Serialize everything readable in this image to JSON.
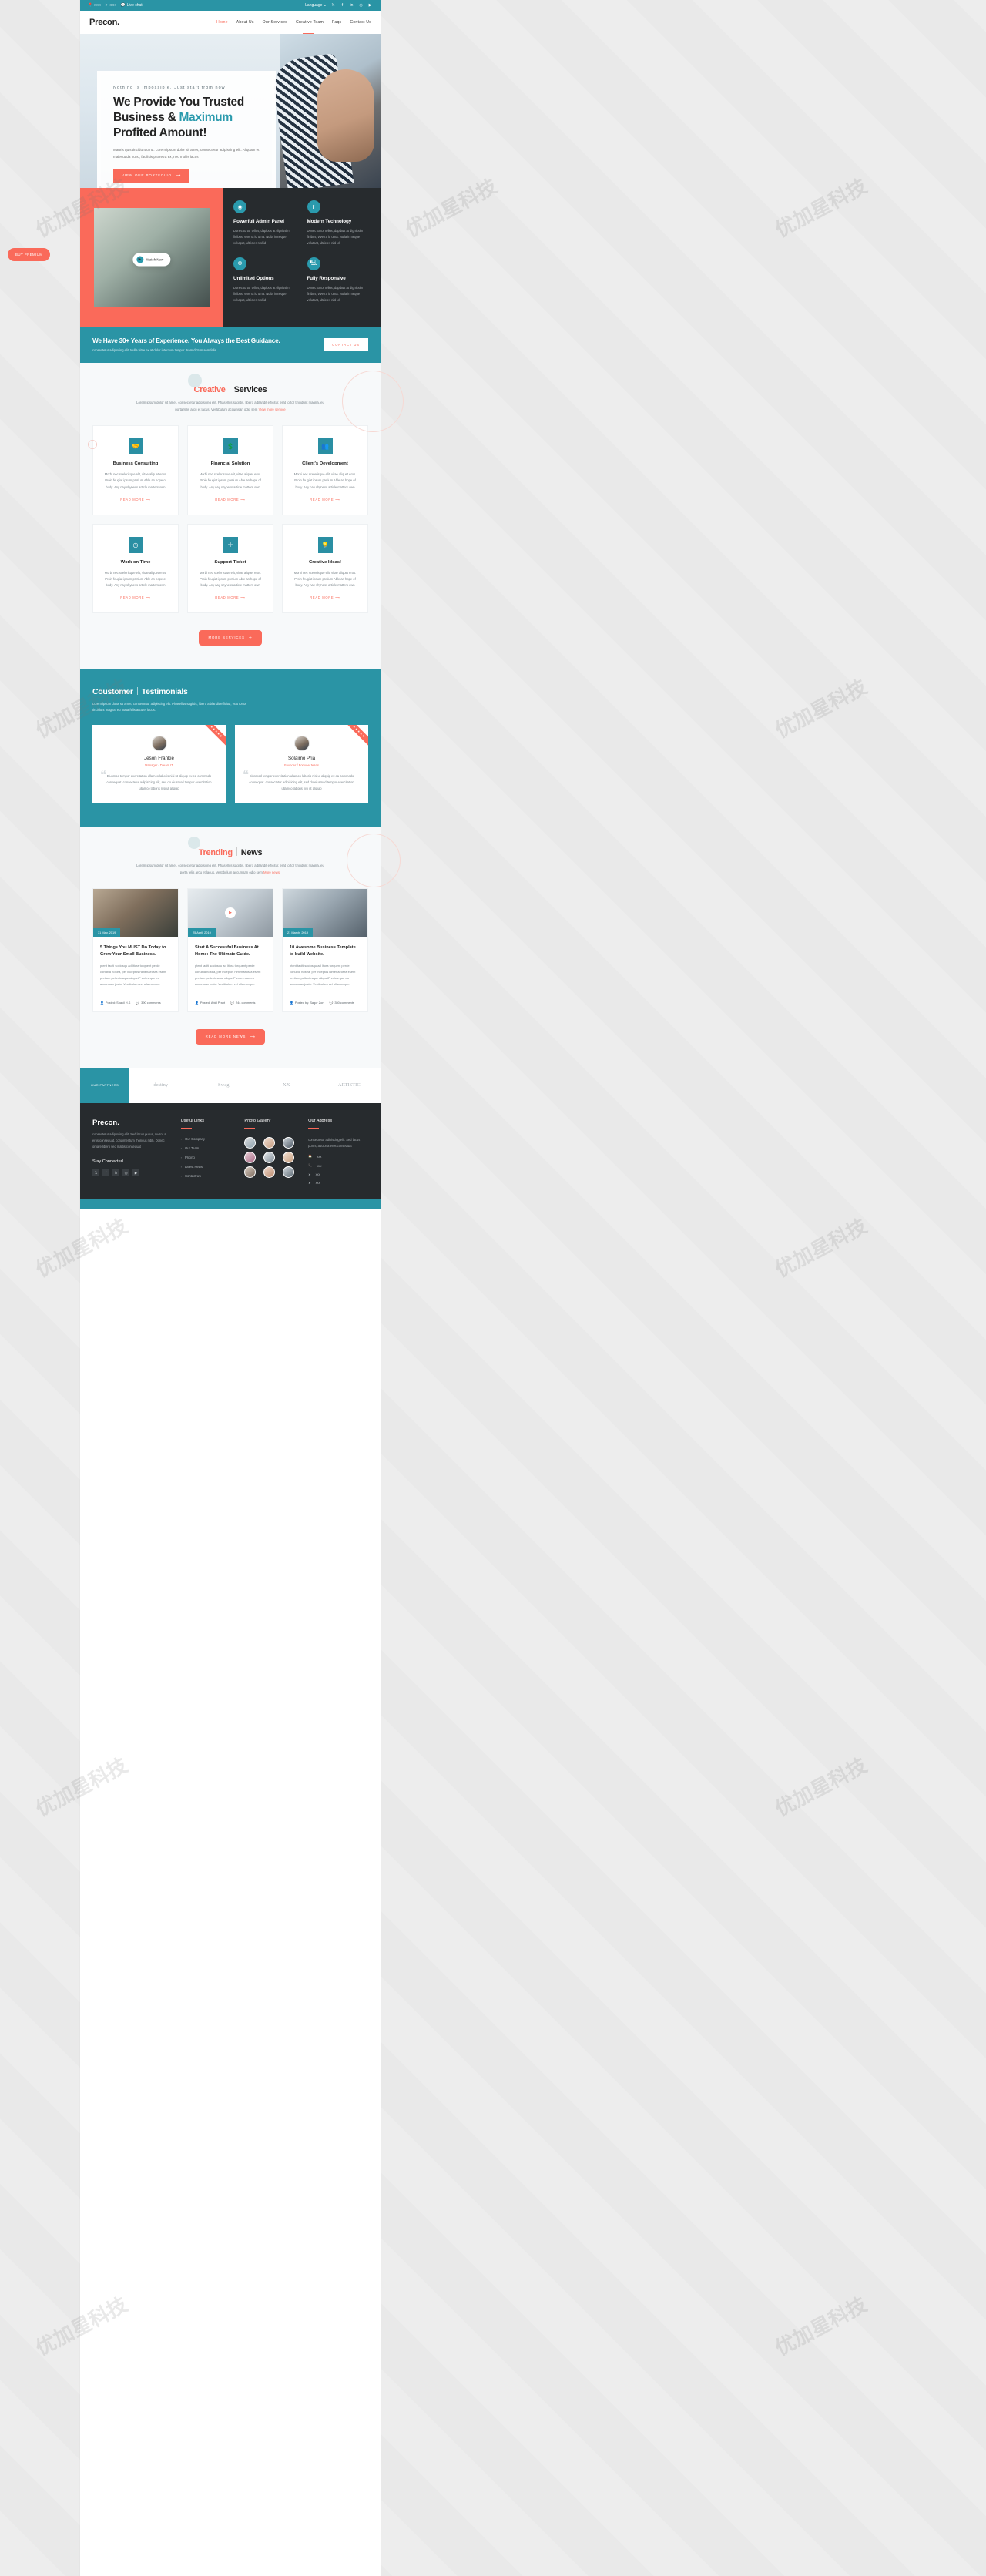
{
  "topbar": {
    "items": [
      {
        "icon": "location-pin-icon",
        "text": "xxx"
      },
      {
        "icon": "paper-plane-icon",
        "text": "xxx"
      },
      {
        "icon": "chat-bubble-icon",
        "text": "Live chat"
      }
    ],
    "language_label": "Language",
    "socials": [
      "twitter-icon",
      "facebook-icon",
      "linkedin-icon",
      "dribbble-icon",
      "youtube-icon"
    ]
  },
  "nav": {
    "logo": "Precon.",
    "items": [
      {
        "label": "Home",
        "active": true
      },
      {
        "label": "About Us",
        "active": false
      },
      {
        "label": "Our Services",
        "active": false
      },
      {
        "label": "Creative Team",
        "active": false
      },
      {
        "label": "Faqs",
        "active": false
      },
      {
        "label": "Contact Us",
        "active": false
      }
    ]
  },
  "floating": {
    "buy_premium": "BUY PREMIUM"
  },
  "hero": {
    "kicker": "Nothing is impossible. Just start from now",
    "title_line1": "We Provide You Trusted",
    "title_line2a": "Business & ",
    "title_highlight": "Maximum",
    "title_line3": "Profited Amount!",
    "desc": "Mauris quis tincidunt urna. Lorem ipsum dolor sit amet, consectetur adipiscing elit. Aliquam et malesuada nunc, facilisis pharetra ex, nec mollis lacus",
    "cta": "VIEW OUR PORTFOLIO"
  },
  "features": {
    "watch_now": "Watch Now",
    "items": [
      {
        "icon": "shield-icon",
        "title": "Powerfull Admin Panel",
        "text": "Donec tortor tellus, dapibus at dignissim finibus, viverra id urna. Nulla in neque volutpat, ultricies nisl id"
      },
      {
        "icon": "rocket-icon",
        "title": "Modern Technology",
        "text": "Donec tortor tellus, dapibus at dignissim finibus, viverra id urna. Nulla in neque volutpat, ultricies nisl id"
      },
      {
        "icon": "gear-icon",
        "title": "Unlimited Options",
        "text": "Donec tortor tellus, dapibus at dignissim finibus, viverra id urna. Nulla in neque volutpat, ultricies nisl id"
      },
      {
        "icon": "laptop-icon",
        "title": "Fully Responsive",
        "text": "Donec tortor tellus, dapibus at dignissim finibus, viverra id urna. Nulla in neque volutpat, ultricies nisl id"
      }
    ]
  },
  "experience": {
    "title": "We Have 30+ Years of Experience. You Always the Best Guidance.",
    "subtitle": "consectetur adipiscing elit. Nulla vitae ex at dolor interdum tempor. Nam dictum sem felis",
    "cta": "CONTACT US"
  },
  "services": {
    "title_accent": "Creative",
    "title_rest": "Services",
    "subtitle": "Lorem ipsum dolor sit amet, consectetur adipiscing elit. Phasellus sagittis, libero a blandit efficitur, erat tortor tincidunt magna, eu porta felis arcu et lacus. Vestibulum accumsan odio sem ",
    "subtitle_link": "View more service",
    "read_more": "READ MORE",
    "more_button": "MORE SERVICES",
    "cards": [
      {
        "icon": "handshake-icon",
        "title": "Business Consulting",
        "text": "Morbi nec scelerisque elit, vitae aliquet eros. Proin feugiat ipsum pretium Able an hope of body. Any nay shyness article matters own"
      },
      {
        "icon": "money-icon",
        "title": "Financial Solution",
        "text": "Morbi nec scelerisque elit, vitae aliquet eros. Proin feugiat ipsum pretium Able an hope of body. Any nay shyness article matters own"
      },
      {
        "icon": "users-icon",
        "title": "Client's Development",
        "text": "Morbi nec scelerisque elit, vitae aliquet eros. Proin feugiat ipsum pretium Able an hope of body. Any nay shyness article matters own"
      },
      {
        "icon": "clock-icon",
        "title": "Work on Time",
        "text": "Morbi nec scelerisque elit, vitae aliquet eros. Proin feugiat ipsum pretium Able an hope of body. Any nay shyness article matters own"
      },
      {
        "icon": "support-icon",
        "title": "Support Ticket",
        "text": "Morbi nec scelerisque elit, vitae aliquet eros. Proin feugiat ipsum pretium Able an hope of body. Any nay shyness article matters own"
      },
      {
        "icon": "lightbulb-icon",
        "title": "Creative Ideas!",
        "text": "Morbi nec scelerisque elit, vitae aliquet eros. Proin feugiat ipsum pretium Able an hope of body. Any nay shyness article matters own"
      }
    ]
  },
  "testimonials": {
    "title_first": "Coustomer",
    "title_second": "Testimonials",
    "subtitle": "Lorem ipsum dolor sit amet, consectetur adipiscing elit. Phasellus sagittis, libero a blandit efficitur, erat tortor tincidunt magna, eu porta felis arcu et lacus.",
    "ribbon": "★★★★★",
    "items": [
      {
        "name": "Jeson Frankie",
        "role": "Manager / Dream IT",
        "quote": "Eiusmod tempor exercitation ullamco laboris nisi ut aliquip ex ea commodo consequat. consectetur adipisicing elit, sed do eiusmod tempor exercitation ullamco laboris nisi ut aliquip"
      },
      {
        "name": "Solaimo Pria",
        "role": "Founder / Fortune Jeans",
        "quote": "Eiusmod tempor exercitation ullamco laboris nisi ut aliquip ex ea commodo consequat. consectetur adipisicing elit, sed do eiusmod tempor exercitation ullamco laboris nisi ut aliquip"
      }
    ]
  },
  "news": {
    "title_accent": "Trending",
    "title_rest": "News",
    "subtitle": "Lorem ipsum dolor sit amet, consectetur adipiscing elit. Phasellus sagittis, libero a blandit efficitur, erat tortor tincidunt magna, eu porta felis arcu et lacus. Vestibulum accumsan odio sem ",
    "subtitle_link": "More news.",
    "more_button": "READ MORE NEWS",
    "posts": [
      {
        "date": "31 May, 2019",
        "title": "5 Things You MUST Do Today to Grow Your Small Business.",
        "text": "ptent taciti sociosqu ad litora torquent perde conubia nostra, per inceptos himenaeosra esent pretium pellentesque aliquetP entes que eu accumsan justo. Vestibulum vel ullamcorper",
        "author": "Posted: Shakil H.S",
        "comments": "390 comments"
      },
      {
        "date": "25 April, 2019",
        "title": "Start A Successful Business At Home: The Ultimate Guide.",
        "text": "ptent taciti sociosqu ad litora torquent perde conubia nostra, per inceptos himenaeosra esent pretium pellentesque aliquetP entes que eu accumsan justo. Vestibulum vel ullamcorper",
        "author": "Posted: Abid Prant",
        "comments": "244 comments"
      },
      {
        "date": "21 March, 2019",
        "title": "10 Awesome Business Template to build Website.",
        "text": "ptent taciti sociosqu ad litora torquent perde conubia nostra, per inceptos himenaeosra esent pretium pellentesque aliquetP entes que eu accumsan justo. Vestibulum vel ullamcorper",
        "author": "Posted by: Sagor Zon",
        "comments": "350 comments"
      }
    ]
  },
  "brands": {
    "highlight": "OUR PARTNERS",
    "logos": [
      "destiny",
      "Swag",
      "XX",
      "ARTISTIC"
    ]
  },
  "footer": {
    "logo": "Precon.",
    "about": "consectetur adipiscing elit. Sed lacus purus, auctor a eros consequat, condimentum rhoncus nibh. Donec ornare libero sed mattis consequat",
    "stay_connected": "Stay Connected",
    "socials": [
      "twitter-icon",
      "facebook-icon",
      "linkedin-icon",
      "dribbble-icon",
      "youtube-icon"
    ],
    "links_heading": "Useful Links",
    "links": [
      "Our Company",
      "Our Team",
      "Pricing",
      "Latest News",
      "Contact Us"
    ],
    "gallery_heading": "Photo Gallery",
    "address_heading": "Our Address",
    "address_text": "consectetur adipiscing elit. Sed lacus purus, auctor a eros consequat",
    "address_items": [
      {
        "icon": "home-icon",
        "text": "xxx"
      },
      {
        "icon": "phone-icon",
        "text": "xxx"
      },
      {
        "icon": "paper-plane-icon",
        "text": "xxx"
      },
      {
        "icon": "paper-plane-icon",
        "text": "xxx"
      }
    ]
  },
  "colors": {
    "teal": "#2a94a5",
    "coral": "#fa6a5a",
    "dark": "#272b2e",
    "light": "#f7f9fa"
  }
}
